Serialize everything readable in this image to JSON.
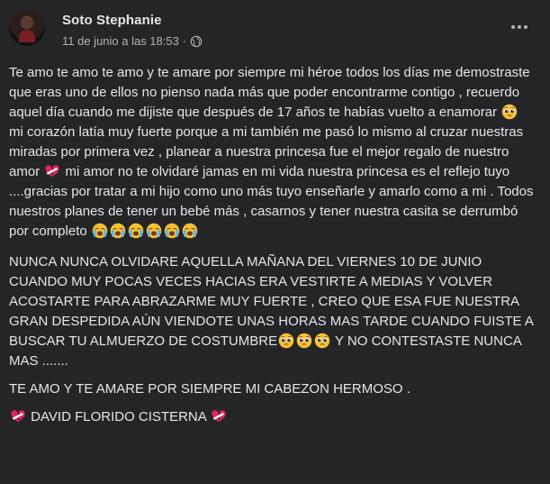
{
  "post": {
    "author": "Soto Stephanie",
    "date": "11 de junio a las 18:53",
    "dot": "·",
    "body": {
      "p1": {
        "t1": "Te amo te amo te amo y te amare por siempre mi  héroe todos los días me demostraste que eras uno de ellos no pienso nada más que poder encontrarme contigo , recuerdo aquel día cuando me dijiste que después de 17 años te habías vuelto a enamorar ",
        "t2": " mi corazón latía muy fuerte porque a mi también me pasó lo mismo al cruzar nuestras miradas por primera vez , planear a nuestra princesa fue el mejor regalo de nuestro amor ",
        "t3": "  mi amor no te olvidaré jamas en mi vida nuestra princesa es el reflejo tuyo ....gracias por tratar a mi hijo como uno más tuyo enseñarle y amarlo como a mi . Todos nuestros planes de tener un bebé más , casarnos y tener nuestra casita se derrumbó por completo "
      },
      "p2": {
        "t1": "NUNCA NUNCA OLVIDARE AQUELLA MAÑANA DEL VIERNES 10 DE JUNIO CUANDO MUY POCAS VECES HACIAS ERA VESTIRTE A MEDIAS Y VOLVER ACOSTARTE PARA ABRAZARME MUY FUERTE , CREO QUE ESA FUE NUESTRA GRAN DESPEDIDA AÚN VIENDOTE UNAS HORAS MAS TARDE CUANDO FUISTE A BUSCAR TU ALMUERZO DE COSTUMBRE",
        "t2": " Y NO CONTESTASTE NUNCA MAS ......."
      },
      "p3": "TE AMO Y TE AMARE POR SIEMPRE MI CABEZON HERMOSO .",
      "p4": " DAVID FLORIDO CISTERNA "
    }
  },
  "icons": {
    "more": "more-options-icon",
    "privacy": "globe-icon",
    "pleading": "pleading-face-emoji",
    "broken_heart": "mending-heart-emoji",
    "crying": "loudly-crying-face-emoji"
  },
  "colors": {
    "background": "#242526",
    "primary_text": "#e4e6eb",
    "secondary_text": "#b0b3b8"
  }
}
